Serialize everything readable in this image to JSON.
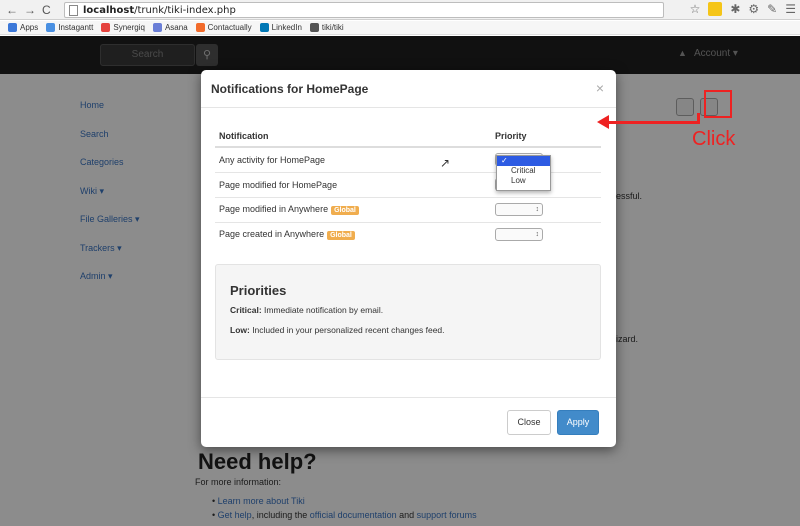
{
  "browser": {
    "url_host": "localhost",
    "url_path": "/trunk/tiki-index.php",
    "bookmarks": [
      {
        "label": "Apps",
        "color": "#3c78d8"
      },
      {
        "label": "Instagantt",
        "color": "#4a90e2"
      },
      {
        "label": "Synergiq",
        "color": "#e5433e"
      },
      {
        "label": "Asana",
        "color": "#6b7fd7"
      },
      {
        "label": "Contactually",
        "color": "#f26b2b"
      },
      {
        "label": "LinkedIn",
        "color": "#0077b5"
      },
      {
        "label": "tiki/tiki",
        "color": "#555555"
      }
    ]
  },
  "topnav": {
    "search_placeholder": "Search",
    "account": "Account ▾"
  },
  "sidebar": [
    "Home",
    "Search",
    "Categories",
    "Wiki ▾",
    "File Galleries ▾",
    "Trackers ▾",
    "Admin ▾"
  ],
  "background": {
    "frag1": "essful.",
    "frag2": "izard.",
    "need_help": "Need help?",
    "more_info": "For more information:",
    "bullet1": "Learn more about Tiki",
    "bullet2_a": "Get help",
    "bullet2_b": ", including the ",
    "bullet2_c": "official documentation",
    "bullet2_d": " and ",
    "bullet2_e": "support forums"
  },
  "modal": {
    "title": "Notifications for HomePage",
    "close_glyph": "×",
    "columns": {
      "notification": "Notification",
      "priority": "Priority"
    },
    "rows": [
      {
        "label": "Any activity for HomePage",
        "badge": ""
      },
      {
        "label": "Page modified for HomePage",
        "badge": ""
      },
      {
        "label": "Page modified in Anywhere",
        "badge": "Global"
      },
      {
        "label": "Page created in Anywhere",
        "badge": "Global"
      }
    ],
    "select_glyph": "↕",
    "dropdown_options": [
      "✓",
      "Critical",
      "Low"
    ],
    "priorities": {
      "heading": "Priorities",
      "critical_label": "Critical:",
      "critical_text": " Immediate notification by email.",
      "low_label": "Low:",
      "low_text": " Included in your personalized recent changes feed."
    },
    "buttons": {
      "close": "Close",
      "apply": "Apply"
    }
  },
  "annotation": {
    "label": "Click",
    "color": "#ee2222"
  }
}
